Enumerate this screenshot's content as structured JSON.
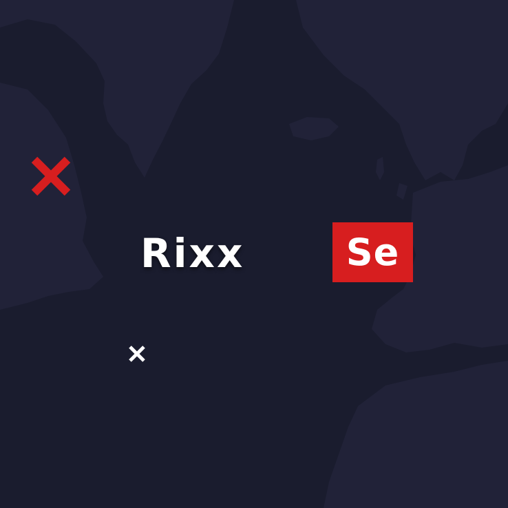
{
  "colors": {
    "background": "#1a1c2e",
    "landmass": "#212238",
    "accent_red": "#d71e1f",
    "text_white": "#ffffff"
  },
  "icons": {
    "large_mark": "red-x-icon",
    "small_mark": "white-x-icon"
  },
  "brand": {
    "left_text": "Rixx",
    "badge_text": "Se"
  }
}
